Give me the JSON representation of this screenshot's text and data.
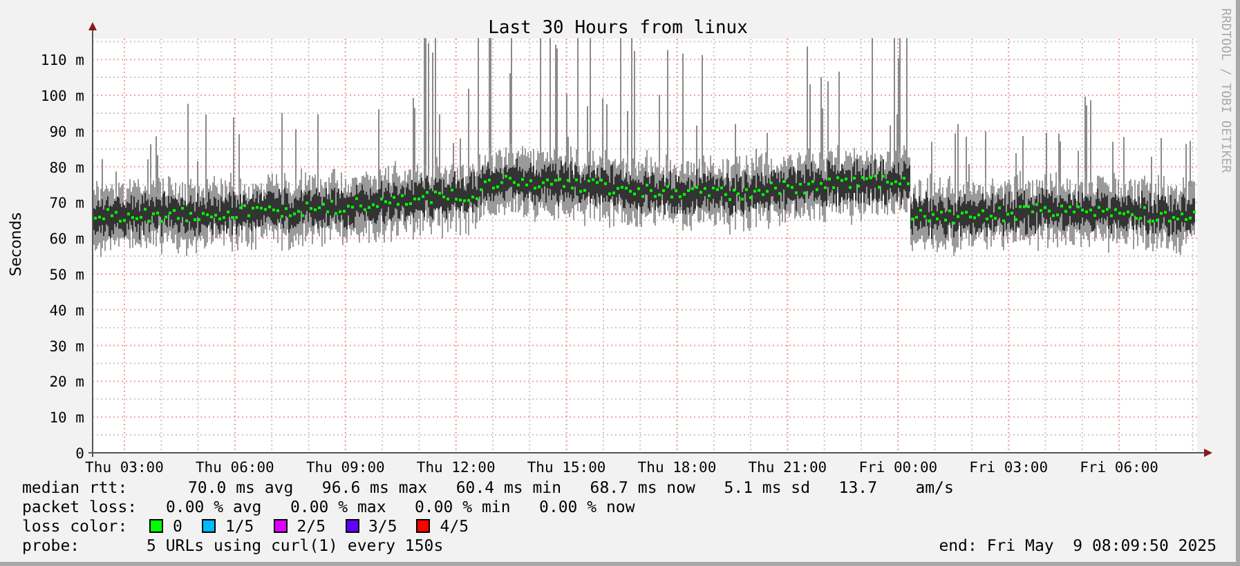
{
  "title": "Last 30 Hours from linux",
  "y_axis": {
    "label": "Seconds",
    "ticks": [
      "110 m",
      "100 m",
      "90 m",
      "80 m",
      "70 m",
      "60 m",
      "50 m",
      "40 m",
      "30 m",
      "20 m",
      "10 m",
      "0"
    ]
  },
  "x_axis": {
    "ticks": [
      "Thu 03:00",
      "Thu 06:00",
      "Thu 09:00",
      "Thu 12:00",
      "Thu 15:00",
      "Thu 18:00",
      "Thu 21:00",
      "Fri 00:00",
      "Fri 03:00",
      "Fri 06:00"
    ]
  },
  "credit": "RRDTOOL / TOBI OETIKER",
  "legend": {
    "median_rtt": {
      "label": "median rtt:",
      "values": "70.0 ms avg   96.6 ms max   60.4 ms min   68.7 ms now   5.1 ms sd   13.7    am/s"
    },
    "packet_loss": {
      "label": "packet loss:",
      "values": "0.00 % avg   0.00 % max   0.00 % min   0.00 % now"
    },
    "loss_color": {
      "label": "loss color:",
      "items": [
        {
          "text": "0",
          "color": "#00ff00"
        },
        {
          "text": "1/5",
          "color": "#00b8ff"
        },
        {
          "text": "2/5",
          "color": "#e000ff"
        },
        {
          "text": "3/5",
          "color": "#6000ff"
        },
        {
          "text": "4/5",
          "color": "#ff0000"
        }
      ]
    },
    "probe": {
      "label": "probe:",
      "values": "5 URLs using curl(1) every 150s",
      "end": "end: Fri May  9 08:09:50 2025"
    }
  }
}
